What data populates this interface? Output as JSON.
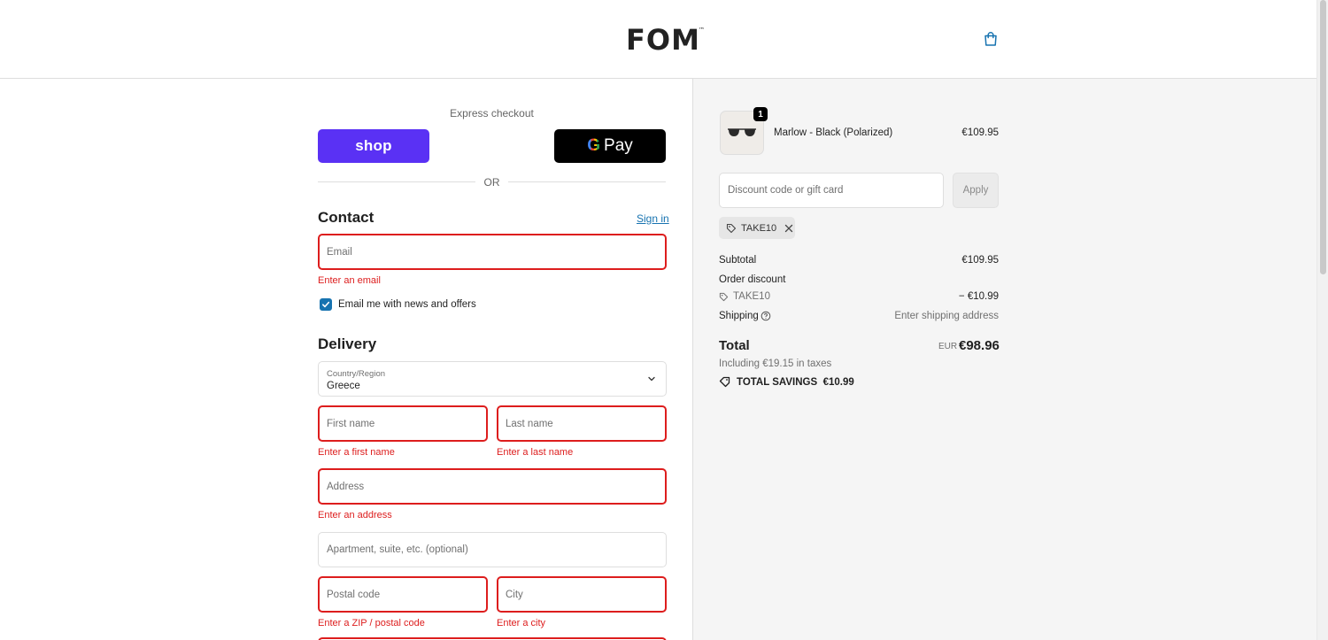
{
  "header": {
    "logo": "FOM",
    "logo_tm": "™",
    "cart_icon": "shopping-bag-icon"
  },
  "express": {
    "label": "Express checkout",
    "shop_label": "shop",
    "gpay_g": "G",
    "gpay_label": "Pay",
    "or": "OR"
  },
  "contact": {
    "title": "Contact",
    "signin": "Sign in",
    "email_placeholder": "Email",
    "email_error": "Enter an email",
    "newsletter_label": "Email me with news and offers",
    "newsletter_checked": true
  },
  "delivery": {
    "title": "Delivery",
    "country_label": "Country/Region",
    "country_value": "Greece",
    "first_name_placeholder": "First name",
    "first_name_error": "Enter a first name",
    "last_name_placeholder": "Last name",
    "last_name_error": "Enter a last name",
    "address_placeholder": "Address",
    "address_error": "Enter an address",
    "apartment_placeholder": "Apartment, suite, etc. (optional)",
    "postal_placeholder": "Postal code",
    "postal_error": "Enter a ZIP / postal code",
    "city_placeholder": "City",
    "city_error": "Enter a city"
  },
  "summary": {
    "item": {
      "quantity": "1",
      "name": "Marlow - Black (Polarized)",
      "price": "€109.95"
    },
    "discount_placeholder": "Discount code or gift card",
    "apply": "Apply",
    "applied_code": "TAKE10",
    "subtotal_label": "Subtotal",
    "subtotal_value": "€109.95",
    "order_discount_label": "Order discount",
    "discount_code": "TAKE10",
    "discount_value": "− €10.99",
    "shipping_label": "Shipping",
    "shipping_value": "Enter shipping address",
    "total_label": "Total",
    "total_currency": "EUR",
    "total_value": "€98.96",
    "taxes": "Including €19.15 in taxes",
    "savings_label": "TOTAL SAVINGS",
    "savings_value": "€10.99"
  },
  "colors": {
    "accent": "#1773b0",
    "error": "#dd1d1d",
    "shop": "#5a31f4",
    "panel": "#f5f5f5"
  }
}
